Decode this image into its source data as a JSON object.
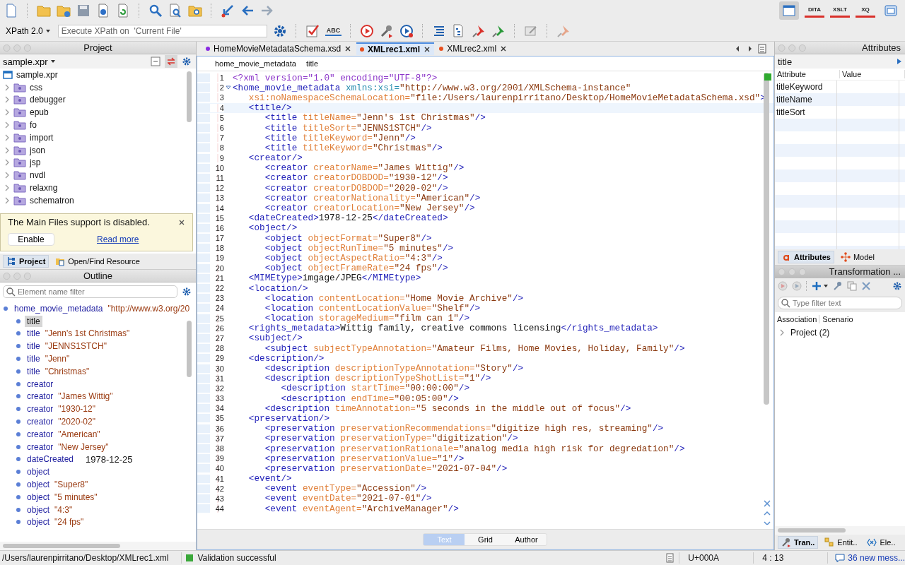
{
  "toolbar": {
    "spell_check_label": "ABC",
    "xpath_version": "XPath 2.0",
    "xpath_placeholder": "Execute XPath on  'Current File'",
    "perspectives": [
      {
        "kind": "editor",
        "selected": true
      },
      {
        "kind": "labeled",
        "label": "DITA",
        "selected": false
      },
      {
        "kind": "labeled",
        "label": "XSLT",
        "selected": false
      },
      {
        "kind": "labeled",
        "label": "XQ",
        "selected": false
      },
      {
        "kind": "database",
        "selected": false
      }
    ]
  },
  "project": {
    "title": "Project",
    "file": "sample.xpr",
    "tree": {
      "name": "sample.xpr",
      "expanded": true,
      "children": [
        {
          "name": "css",
          "expanded": false
        },
        {
          "name": "debugger",
          "expanded": false
        },
        {
          "name": "epub",
          "expanded": false
        },
        {
          "name": "fo",
          "expanded": false
        },
        {
          "name": "import",
          "expanded": false
        },
        {
          "name": "json",
          "expanded": false
        },
        {
          "name": "jsp",
          "expanded": false
        },
        {
          "name": "nvdl",
          "expanded": false
        },
        {
          "name": "relaxng",
          "expanded": false
        },
        {
          "name": "schematron",
          "expanded": false
        }
      ]
    }
  },
  "notice": {
    "message": "The Main Files support is disabled.",
    "button": "Enable",
    "link": "Read more"
  },
  "left_tabs": [
    {
      "label": "Project",
      "selected": true
    },
    {
      "label": "Open/Find Resource",
      "selected": false
    }
  ],
  "outline": {
    "title": "Outline",
    "filter_placeholder": "Element name filter",
    "tree": [
      {
        "name": "home_movie_metadata",
        "value": "\"http://www.w3.org/20",
        "quoted": true,
        "selected": false,
        "children": [
          {
            "name": "title",
            "selected": true
          },
          {
            "name": "title",
            "value": "\"Jenn's 1st Christmas\"",
            "quoted": true,
            "selected": false
          },
          {
            "name": "title",
            "value": "\"JENNS1STCH\"",
            "quoted": true,
            "selected": false
          },
          {
            "name": "title",
            "value": "\"Jenn\"",
            "quoted": true,
            "selected": false
          },
          {
            "name": "title",
            "value": "\"Christmas\"",
            "quoted": true,
            "selected": false
          },
          {
            "name": "creator",
            "selected": false
          },
          {
            "name": "creator",
            "value": "\"James Wittig\"",
            "quoted": true,
            "selected": false
          },
          {
            "name": "creator",
            "value": "\"1930-12\"",
            "quoted": true,
            "selected": false
          },
          {
            "name": "creator",
            "value": "\"2020-02\"",
            "quoted": true,
            "selected": false
          },
          {
            "name": "creator",
            "value": "\"American\"",
            "quoted": true,
            "selected": false
          },
          {
            "name": "creator",
            "value": "\"New Jersey\"",
            "quoted": true,
            "selected": false
          },
          {
            "name": "dateCreated",
            "value": "1978-12-25",
            "quoted": false,
            "selected": false
          },
          {
            "name": "object",
            "selected": false
          },
          {
            "name": "object",
            "value": "\"Super8\"",
            "quoted": true,
            "selected": false
          },
          {
            "name": "object",
            "value": "\"5 minutes\"",
            "quoted": true,
            "selected": false
          },
          {
            "name": "object",
            "value": "\"4:3\"",
            "quoted": true,
            "selected": false
          },
          {
            "name": "object",
            "value": "\"24 fps\"",
            "quoted": true,
            "selected": false
          }
        ]
      }
    ]
  },
  "editor": {
    "tabs": [
      {
        "label": "HomeMovieMetadataSchema.xsd",
        "color": "#8a2be2",
        "selected": false
      },
      {
        "label": "XMLrec1.xml",
        "color": "#e8501e",
        "selected": true
      },
      {
        "label": "XMLrec2.xml",
        "color": "#e8501e",
        "selected": false
      }
    ],
    "breadcrumb": [
      "home_movie_metadata",
      "title"
    ],
    "lines": [
      {
        "n": "1",
        "current": false,
        "fold": false,
        "tokens": [
          {
            "kind": "pi",
            "text": "<?xml version=\"1.0\" encoding=\"UTF-8\"?>"
          }
        ]
      },
      {
        "n": "2",
        "current": false,
        "fold": true,
        "tokens": [
          {
            "kind": "tag",
            "text": "<home_movie_metadata "
          },
          {
            "kind": "ns",
            "text": "xmlns:xsi="
          },
          {
            "kind": "val",
            "text": "\"http://www.w3.org/2001/XMLSchema-instance\""
          }
        ]
      },
      {
        "n": "3",
        "current": false,
        "fold": false,
        "tokens": [
          {
            "kind": "attr",
            "text": "   xsi:noNamespaceSchemaLocation="
          },
          {
            "kind": "val",
            "text": "\"file:/Users/laurenpirritano/Desktop/HomeMovieMetadataSchema.xsd\""
          },
          {
            "kind": "tag",
            "text": ">"
          }
        ]
      },
      {
        "n": "4",
        "current": true,
        "fold": false,
        "tokens": [
          {
            "kind": "tag",
            "text": "   <title/>"
          }
        ]
      },
      {
        "n": "5",
        "current": false,
        "fold": false,
        "tokens": [
          {
            "kind": "tag",
            "text": "      <title "
          },
          {
            "kind": "attr",
            "text": "titleName="
          },
          {
            "kind": "val",
            "text": "\"Jenn's 1st Christmas\""
          },
          {
            "kind": "tag",
            "text": "/>"
          }
        ]
      },
      {
        "n": "6",
        "current": false,
        "fold": false,
        "tokens": [
          {
            "kind": "tag",
            "text": "      <title "
          },
          {
            "kind": "attr",
            "text": "titleSort="
          },
          {
            "kind": "val",
            "text": "\"JENNS1STCH\""
          },
          {
            "kind": "tag",
            "text": "/>"
          }
        ]
      },
      {
        "n": "7",
        "current": false,
        "fold": false,
        "tokens": [
          {
            "kind": "tag",
            "text": "      <title "
          },
          {
            "kind": "attr",
            "text": "titleKeyword="
          },
          {
            "kind": "val",
            "text": "\"Jenn\""
          },
          {
            "kind": "tag",
            "text": "/>"
          }
        ]
      },
      {
        "n": "8",
        "current": false,
        "fold": false,
        "tokens": [
          {
            "kind": "tag",
            "text": "      <title "
          },
          {
            "kind": "attr",
            "text": "titleKeyword="
          },
          {
            "kind": "val",
            "text": "\"Christmas\""
          },
          {
            "kind": "tag",
            "text": "/>"
          }
        ]
      },
      {
        "n": "9",
        "current": false,
        "fold": false,
        "tokens": [
          {
            "kind": "tag",
            "text": "   <creator/>"
          }
        ]
      },
      {
        "n": "10",
        "current": false,
        "fold": false,
        "tokens": [
          {
            "kind": "tag",
            "text": "      <creator "
          },
          {
            "kind": "attr",
            "text": "creatorName="
          },
          {
            "kind": "val",
            "text": "\"James Wittig\""
          },
          {
            "kind": "tag",
            "text": "/>"
          }
        ]
      },
      {
        "n": "11",
        "current": false,
        "fold": false,
        "tokens": [
          {
            "kind": "tag",
            "text": "      <creator "
          },
          {
            "kind": "attr",
            "text": "creatorDOBDOD="
          },
          {
            "kind": "val",
            "text": "\"1930-12\""
          },
          {
            "kind": "tag",
            "text": "/>"
          }
        ]
      },
      {
        "n": "12",
        "current": false,
        "fold": false,
        "tokens": [
          {
            "kind": "tag",
            "text": "      <creator "
          },
          {
            "kind": "attr",
            "text": "creatorDOBDOD="
          },
          {
            "kind": "val",
            "text": "\"2020-02\""
          },
          {
            "kind": "tag",
            "text": "/>"
          }
        ]
      },
      {
        "n": "13",
        "current": false,
        "fold": false,
        "tokens": [
          {
            "kind": "tag",
            "text": "      <creator "
          },
          {
            "kind": "attr",
            "text": "creatorNationality="
          },
          {
            "kind": "val",
            "text": "\"American\""
          },
          {
            "kind": "tag",
            "text": "/>"
          }
        ]
      },
      {
        "n": "14",
        "current": false,
        "fold": false,
        "tokens": [
          {
            "kind": "tag",
            "text": "      <creator "
          },
          {
            "kind": "attr",
            "text": "creatorLocation="
          },
          {
            "kind": "val",
            "text": "\"New Jersey\""
          },
          {
            "kind": "tag",
            "text": "/>"
          }
        ]
      },
      {
        "n": "15",
        "current": false,
        "fold": false,
        "tokens": [
          {
            "kind": "tag",
            "text": "   <dateCreated>"
          },
          {
            "kind": "text",
            "text": "1978-12-25"
          },
          {
            "kind": "tag",
            "text": "</dateCreated>"
          }
        ]
      },
      {
        "n": "16",
        "current": false,
        "fold": false,
        "tokens": [
          {
            "kind": "tag",
            "text": "   <object/>"
          }
        ]
      },
      {
        "n": "17",
        "current": false,
        "fold": false,
        "tokens": [
          {
            "kind": "tag",
            "text": "      <object "
          },
          {
            "kind": "attr",
            "text": "objectFormat="
          },
          {
            "kind": "val",
            "text": "\"Super8\""
          },
          {
            "kind": "tag",
            "text": "/>"
          }
        ]
      },
      {
        "n": "18",
        "current": false,
        "fold": false,
        "tokens": [
          {
            "kind": "tag",
            "text": "      <object "
          },
          {
            "kind": "attr",
            "text": "objectRunTime="
          },
          {
            "kind": "val",
            "text": "\"5 minutes\""
          },
          {
            "kind": "tag",
            "text": "/>"
          }
        ]
      },
      {
        "n": "19",
        "current": false,
        "fold": false,
        "tokens": [
          {
            "kind": "tag",
            "text": "      <object "
          },
          {
            "kind": "attr",
            "text": "objectAspectRatio="
          },
          {
            "kind": "val",
            "text": "\"4:3\""
          },
          {
            "kind": "tag",
            "text": "/>"
          }
        ]
      },
      {
        "n": "20",
        "current": false,
        "fold": false,
        "tokens": [
          {
            "kind": "tag",
            "text": "      <object "
          },
          {
            "kind": "attr",
            "text": "objectFrameRate="
          },
          {
            "kind": "val",
            "text": "\"24 fps\""
          },
          {
            "kind": "tag",
            "text": "/>"
          }
        ]
      },
      {
        "n": "21",
        "current": false,
        "fold": false,
        "tokens": [
          {
            "kind": "tag",
            "text": "   <MIMEtype>"
          },
          {
            "kind": "text",
            "text": "imgage/JPEG"
          },
          {
            "kind": "tag",
            "text": "</MIMEtype>"
          }
        ]
      },
      {
        "n": "22",
        "current": false,
        "fold": false,
        "tokens": [
          {
            "kind": "tag",
            "text": "   <location/>"
          }
        ]
      },
      {
        "n": "23",
        "current": false,
        "fold": false,
        "tokens": [
          {
            "kind": "tag",
            "text": "      <location "
          },
          {
            "kind": "attr",
            "text": "contentLocation="
          },
          {
            "kind": "val",
            "text": "\"Home Movie Archive\""
          },
          {
            "kind": "tag",
            "text": "/>"
          }
        ]
      },
      {
        "n": "24",
        "current": false,
        "fold": false,
        "tokens": [
          {
            "kind": "tag",
            "text": "      <location "
          },
          {
            "kind": "attr",
            "text": "contentLocationValue="
          },
          {
            "kind": "val",
            "text": "\"Shelf\""
          },
          {
            "kind": "tag",
            "text": "/>"
          }
        ]
      },
      {
        "n": "25",
        "current": false,
        "fold": false,
        "tokens": [
          {
            "kind": "tag",
            "text": "      <location "
          },
          {
            "kind": "attr",
            "text": "storageMedium="
          },
          {
            "kind": "val",
            "text": "\"film can 1\""
          },
          {
            "kind": "tag",
            "text": "/>"
          }
        ]
      },
      {
        "n": "26",
        "current": false,
        "fold": false,
        "tokens": [
          {
            "kind": "tag",
            "text": "   <rights_metadata>"
          },
          {
            "kind": "text",
            "text": "Wittig family, creative commons licensing"
          },
          {
            "kind": "tag",
            "text": "</rights_metadata>"
          }
        ]
      },
      {
        "n": "27",
        "current": false,
        "fold": false,
        "tokens": [
          {
            "kind": "tag",
            "text": "   <subject/>"
          }
        ]
      },
      {
        "n": "28",
        "current": false,
        "fold": false,
        "tokens": [
          {
            "kind": "tag",
            "text": "      <subject "
          },
          {
            "kind": "attr",
            "text": "subjectTypeAnnotation="
          },
          {
            "kind": "val",
            "text": "\"Amateur Films, Home Movies, Holiday, Family\""
          },
          {
            "kind": "tag",
            "text": "/>"
          }
        ]
      },
      {
        "n": "29",
        "current": false,
        "fold": false,
        "tokens": [
          {
            "kind": "tag",
            "text": "   <description/>"
          }
        ]
      },
      {
        "n": "30",
        "current": false,
        "fold": false,
        "tokens": [
          {
            "kind": "tag",
            "text": "      <description "
          },
          {
            "kind": "attr",
            "text": "descriptionTypeAnnotation="
          },
          {
            "kind": "val",
            "text": "\"Story\""
          },
          {
            "kind": "tag",
            "text": "/>"
          }
        ]
      },
      {
        "n": "31",
        "current": false,
        "fold": false,
        "tokens": [
          {
            "kind": "tag",
            "text": "      <description "
          },
          {
            "kind": "attr",
            "text": "descriptionTypeShotList="
          },
          {
            "kind": "val",
            "text": "\"1\""
          },
          {
            "kind": "tag",
            "text": "/>"
          }
        ]
      },
      {
        "n": "32",
        "current": false,
        "fold": false,
        "tokens": [
          {
            "kind": "tag",
            "text": "         <description "
          },
          {
            "kind": "attr",
            "text": "startTime="
          },
          {
            "kind": "val",
            "text": "\"00:00:00\""
          },
          {
            "kind": "tag",
            "text": "/>"
          }
        ]
      },
      {
        "n": "33",
        "current": false,
        "fold": false,
        "tokens": [
          {
            "kind": "tag",
            "text": "         <description "
          },
          {
            "kind": "attr",
            "text": "endTime="
          },
          {
            "kind": "val",
            "text": "\"00:05:00\""
          },
          {
            "kind": "tag",
            "text": "/>"
          }
        ]
      },
      {
        "n": "34",
        "current": false,
        "fold": false,
        "tokens": [
          {
            "kind": "tag",
            "text": "      <description "
          },
          {
            "kind": "attr",
            "text": "timeAnnotation="
          },
          {
            "kind": "val",
            "text": "\"5 seconds in the middle out of focus\""
          },
          {
            "kind": "tag",
            "text": "/>"
          }
        ]
      },
      {
        "n": "35",
        "current": false,
        "fold": false,
        "tokens": [
          {
            "kind": "tag",
            "text": "   <preservation/>"
          }
        ]
      },
      {
        "n": "36",
        "current": false,
        "fold": false,
        "tokens": [
          {
            "kind": "tag",
            "text": "      <preservation "
          },
          {
            "kind": "attr",
            "text": "preservationRecommendations="
          },
          {
            "kind": "val",
            "text": "\"digitize high res, streaming\""
          },
          {
            "kind": "tag",
            "text": "/>"
          }
        ]
      },
      {
        "n": "37",
        "current": false,
        "fold": false,
        "tokens": [
          {
            "kind": "tag",
            "text": "      <preservation "
          },
          {
            "kind": "attr",
            "text": "preservationType="
          },
          {
            "kind": "val",
            "text": "\"digitization\""
          },
          {
            "kind": "tag",
            "text": "/>"
          }
        ]
      },
      {
        "n": "38",
        "current": false,
        "fold": false,
        "tokens": [
          {
            "kind": "tag",
            "text": "      <preservation "
          },
          {
            "kind": "attr",
            "text": "preservationRationale="
          },
          {
            "kind": "val",
            "text": "\"analog media high risk for degredation\""
          },
          {
            "kind": "tag",
            "text": "/>"
          }
        ]
      },
      {
        "n": "39",
        "current": false,
        "fold": false,
        "tokens": [
          {
            "kind": "tag",
            "text": "      <preservation "
          },
          {
            "kind": "attr",
            "text": "preservationValue="
          },
          {
            "kind": "val",
            "text": "\"1\""
          },
          {
            "kind": "tag",
            "text": "/>"
          }
        ]
      },
      {
        "n": "40",
        "current": false,
        "fold": false,
        "tokens": [
          {
            "kind": "tag",
            "text": "      <preservation "
          },
          {
            "kind": "attr",
            "text": "preservationDate="
          },
          {
            "kind": "val",
            "text": "\"2021-07-04\""
          },
          {
            "kind": "tag",
            "text": "/>"
          }
        ]
      },
      {
        "n": "41",
        "current": false,
        "fold": false,
        "tokens": [
          {
            "kind": "tag",
            "text": "   <event/>"
          }
        ]
      },
      {
        "n": "42",
        "current": false,
        "fold": false,
        "tokens": [
          {
            "kind": "tag",
            "text": "      <event "
          },
          {
            "kind": "attr",
            "text": "eventType="
          },
          {
            "kind": "val",
            "text": "\"Accession\""
          },
          {
            "kind": "tag",
            "text": "/>"
          }
        ]
      },
      {
        "n": "43",
        "current": false,
        "fold": false,
        "tokens": [
          {
            "kind": "tag",
            "text": "      <event "
          },
          {
            "kind": "attr",
            "text": "eventDate="
          },
          {
            "kind": "val",
            "text": "\"2021-07-01\""
          },
          {
            "kind": "tag",
            "text": "/>"
          }
        ]
      },
      {
        "n": "44",
        "current": false,
        "fold": false,
        "tokens": [
          {
            "kind": "tag",
            "text": "      <event "
          },
          {
            "kind": "attr",
            "text": "eventAgent="
          },
          {
            "kind": "val",
            "text": "\"ArchiveManager\""
          },
          {
            "kind": "tag",
            "text": "/>"
          }
        ]
      }
    ],
    "modes": [
      {
        "label": "Text",
        "selected": true
      },
      {
        "label": "Grid",
        "selected": false
      },
      {
        "label": "Author",
        "selected": false
      }
    ]
  },
  "attributes": {
    "title": "Attributes",
    "element": "title",
    "columns": [
      "Attribute",
      "Value"
    ],
    "rows": [
      "titleKeyword",
      "titleName",
      "titleSort"
    ],
    "tabs": [
      {
        "label": "Attributes",
        "selected": true
      },
      {
        "label": "Model",
        "selected": false
      }
    ]
  },
  "transformation": {
    "title": "Transformation ...",
    "filter_placeholder": "Type filter text",
    "columns": [
      "Association",
      "Scenario"
    ],
    "tree": [
      {
        "name": "Project (2)",
        "expanded": false
      }
    ]
  },
  "right_tabs": [
    {
      "label": "Tran..",
      "selected": true
    },
    {
      "label": "Entit..",
      "selected": false
    },
    {
      "label": "Ele..",
      "selected": false
    }
  ],
  "status_bar": {
    "path": "/Users/laurenpirritano/Desktop/XMLrec1.xml",
    "validation": "Validation successful",
    "character": "U+000A",
    "position": "4 : 13",
    "messages": "36 new mess..."
  }
}
